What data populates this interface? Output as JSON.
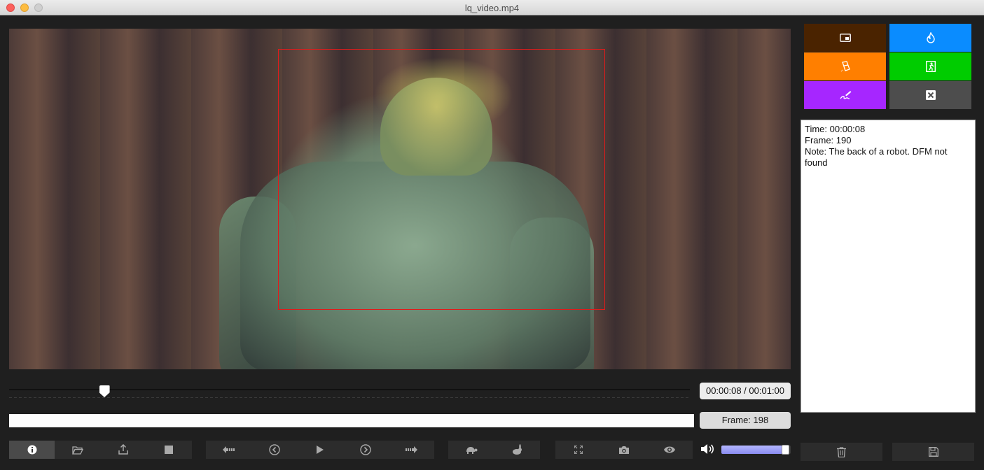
{
  "window": {
    "title": "lq_video.mp4"
  },
  "player": {
    "time_readout": "00:00:08 / 00:01:00",
    "frame_readout": "Frame: 198",
    "playhead_fraction": 0.14,
    "volume_fraction": 0.88
  },
  "notes": {
    "time_line": "Time: 00:00:08",
    "frame_line": "Frame: 190",
    "note_line": "Note: The back of a robot. DFM not found"
  },
  "colors": {
    "tile_brown": "#4a2300",
    "tile_blue": "#0a8cff",
    "tile_orange": "#ff7f00",
    "tile_green": "#00cc00",
    "tile_purple": "#a626ff",
    "tile_gray": "#4d4d4d",
    "roi": "#e01b1b"
  },
  "icons": {
    "file_group": [
      "info-icon",
      "folder-open-icon",
      "export-icon",
      "stop-icon"
    ],
    "nav_group": [
      "step-back-icon",
      "previous-icon",
      "play-icon",
      "next-icon",
      "step-forward-icon"
    ],
    "speed_group": [
      "turtle-icon",
      "rabbit-icon"
    ],
    "view_group": [
      "fullscreen-icon",
      "camera-icon",
      "eye-icon"
    ],
    "tiles": [
      "picture-in-picture-icon",
      "fire-icon",
      "eraser-icon",
      "exit-icon",
      "signature-icon",
      "close-icon"
    ],
    "bottom": [
      "trash-icon",
      "save-icon"
    ]
  }
}
